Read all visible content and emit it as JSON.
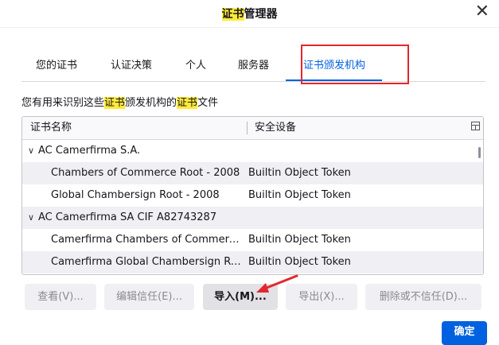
{
  "dialog": {
    "title_hl": "证书",
    "title_rest": "管理器"
  },
  "tabs": [
    {
      "label": "您的证书"
    },
    {
      "label": "认证决策"
    },
    {
      "label": "个人"
    },
    {
      "label": "服务器"
    },
    {
      "label": "证书颁发机构",
      "active": true
    }
  ],
  "description": {
    "p1": "您有用来识别这些",
    "hl1": "证书",
    "p2": "颁发机构的",
    "hl2": "证书",
    "p3": "文件"
  },
  "tree": {
    "columns": [
      "证书名称",
      "安全设备"
    ],
    "rows": [
      {
        "type": "group",
        "name": "AC Camerfirma S.A.",
        "device": ""
      },
      {
        "type": "item",
        "name": "Chambers of Commerce Root - 2008",
        "device": "Builtin Object Token"
      },
      {
        "type": "item",
        "name": "Global Chambersign Root - 2008",
        "device": "Builtin Object Token"
      },
      {
        "type": "group",
        "name": "AC Camerfirma SA CIF A82743287",
        "device": ""
      },
      {
        "type": "item",
        "name": "Camerfirma Chambers of Commerc...",
        "device": "Builtin Object Token"
      },
      {
        "type": "item",
        "name": "Camerfirma Global Chambersign Ro...",
        "device": "Builtin Object Token"
      }
    ]
  },
  "buttons": {
    "view": "查看(V)...",
    "edit_trust": "编辑信任(E)...",
    "import": "导入(M)...",
    "export": "导出(X)...",
    "delete": "删除或不信任(D)...",
    "ok": "确定"
  },
  "icons": {
    "close": "close-icon",
    "twisty": "chevron-down-icon",
    "column_picker": "column-picker-icon"
  },
  "colors": {
    "accent": "#0061e0",
    "highlight": "#ffea3a",
    "annotation": "#e3272d"
  }
}
